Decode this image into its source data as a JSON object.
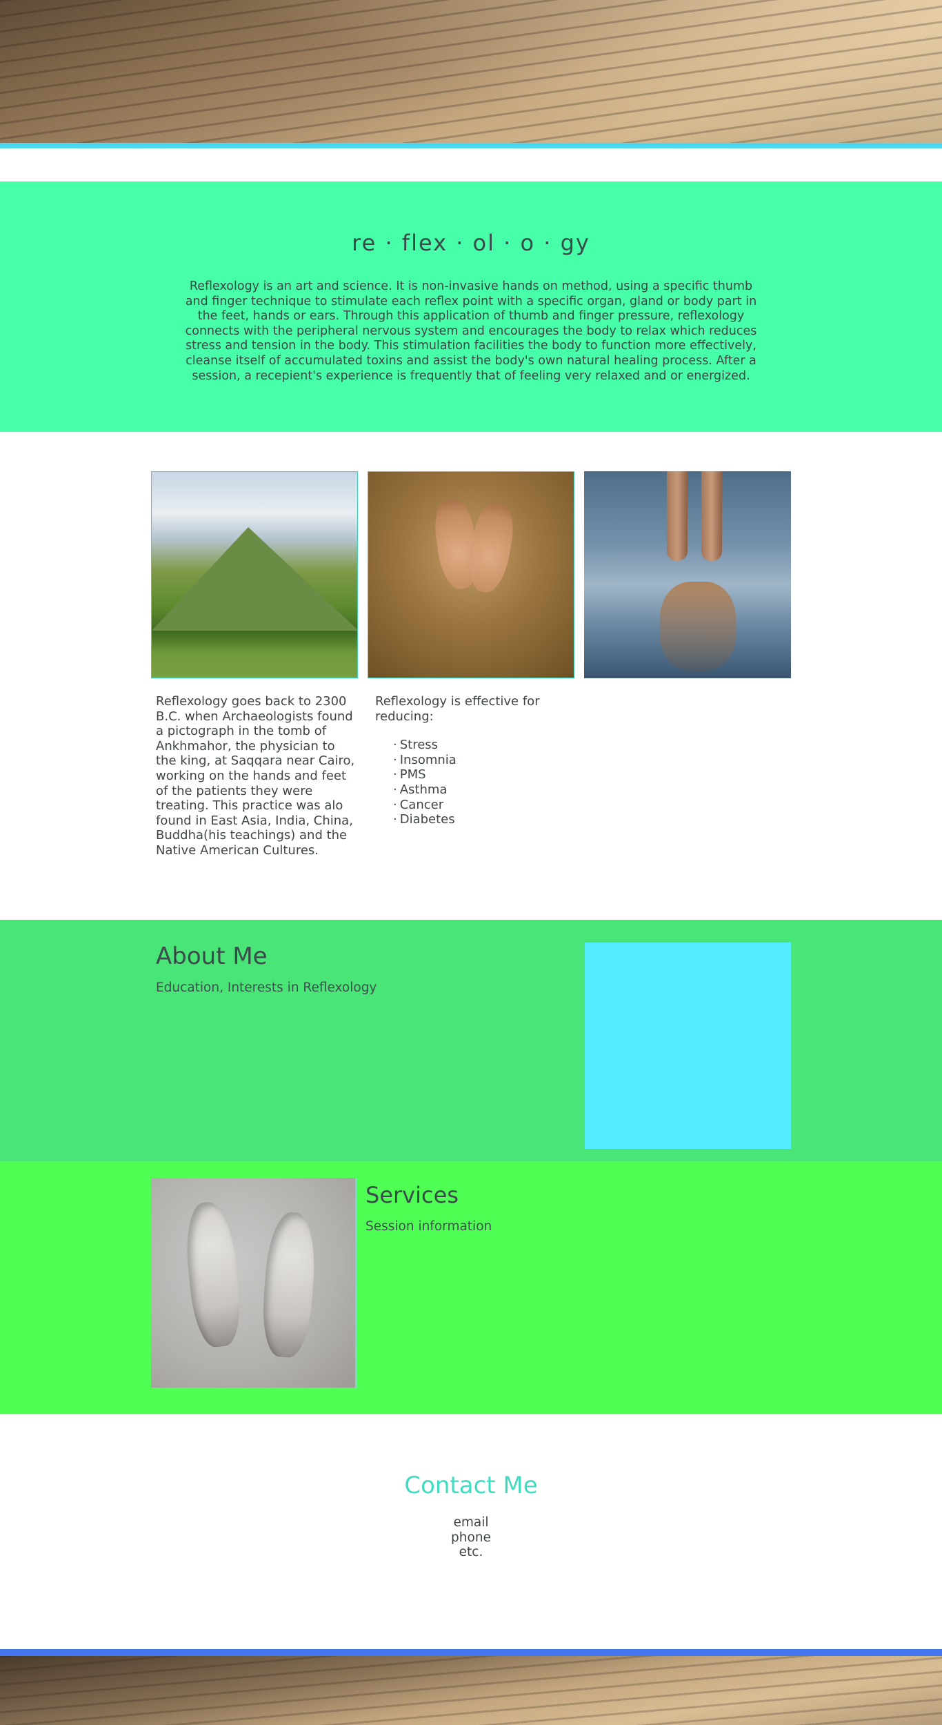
{
  "intro": {
    "title": "re · flex · ol · o · gy",
    "text": "Reflexology is an art and science. It is non-invasive hands on method, using a specific thumb and finger technique to stimulate each reflex point  with a specific organ, gland or body part in the feet, hands or ears. Through this application of thumb and finger pressure, reflexology connects with the peripheral nervous system and encourages the body to relax which reduces stress and tension in the body. This stimulation facilities the body to function more effectively, cleanse itself of accumulated toxins and assist the body's own natural healing process. After a session, a recepient's experience is frequently that of feeling very relaxed and or energized."
  },
  "gallery": {
    "history_text": "Reflexology goes back to 2300 B.C. when Archaeologists found a pictograph in the tomb of Ankhmahor, the physician to the king, at Saqqara near Cairo, working on the hands and feet of the patients they were treating. This practice was alo found in East Asia, India, China, Buddha(his teachings) and the Native American Cultures.",
    "benefits_intro": "Reflexology is effective for reducing:",
    "benefits": [
      "Stress",
      "Insomnia",
      "PMS",
      "Asthma",
      "Cancer",
      "Diabetes"
    ]
  },
  "about": {
    "title": "About Me",
    "subtitle": "Education, Interests in Reflexology"
  },
  "services": {
    "title": "Services",
    "subtitle": "Session information"
  },
  "contact": {
    "title": "Contact Me",
    "lines": [
      "email",
      "phone",
      "etc."
    ]
  },
  "colors": {
    "intro_bg": "#47ffa8",
    "about_bg": "#4ae577",
    "services_bg": "#50ff54",
    "accent_cyan": "#52eeff",
    "contact_title": "#3fdcc0",
    "footer_bar": "#4477ee",
    "hero_bar": "#4fd6f0"
  }
}
